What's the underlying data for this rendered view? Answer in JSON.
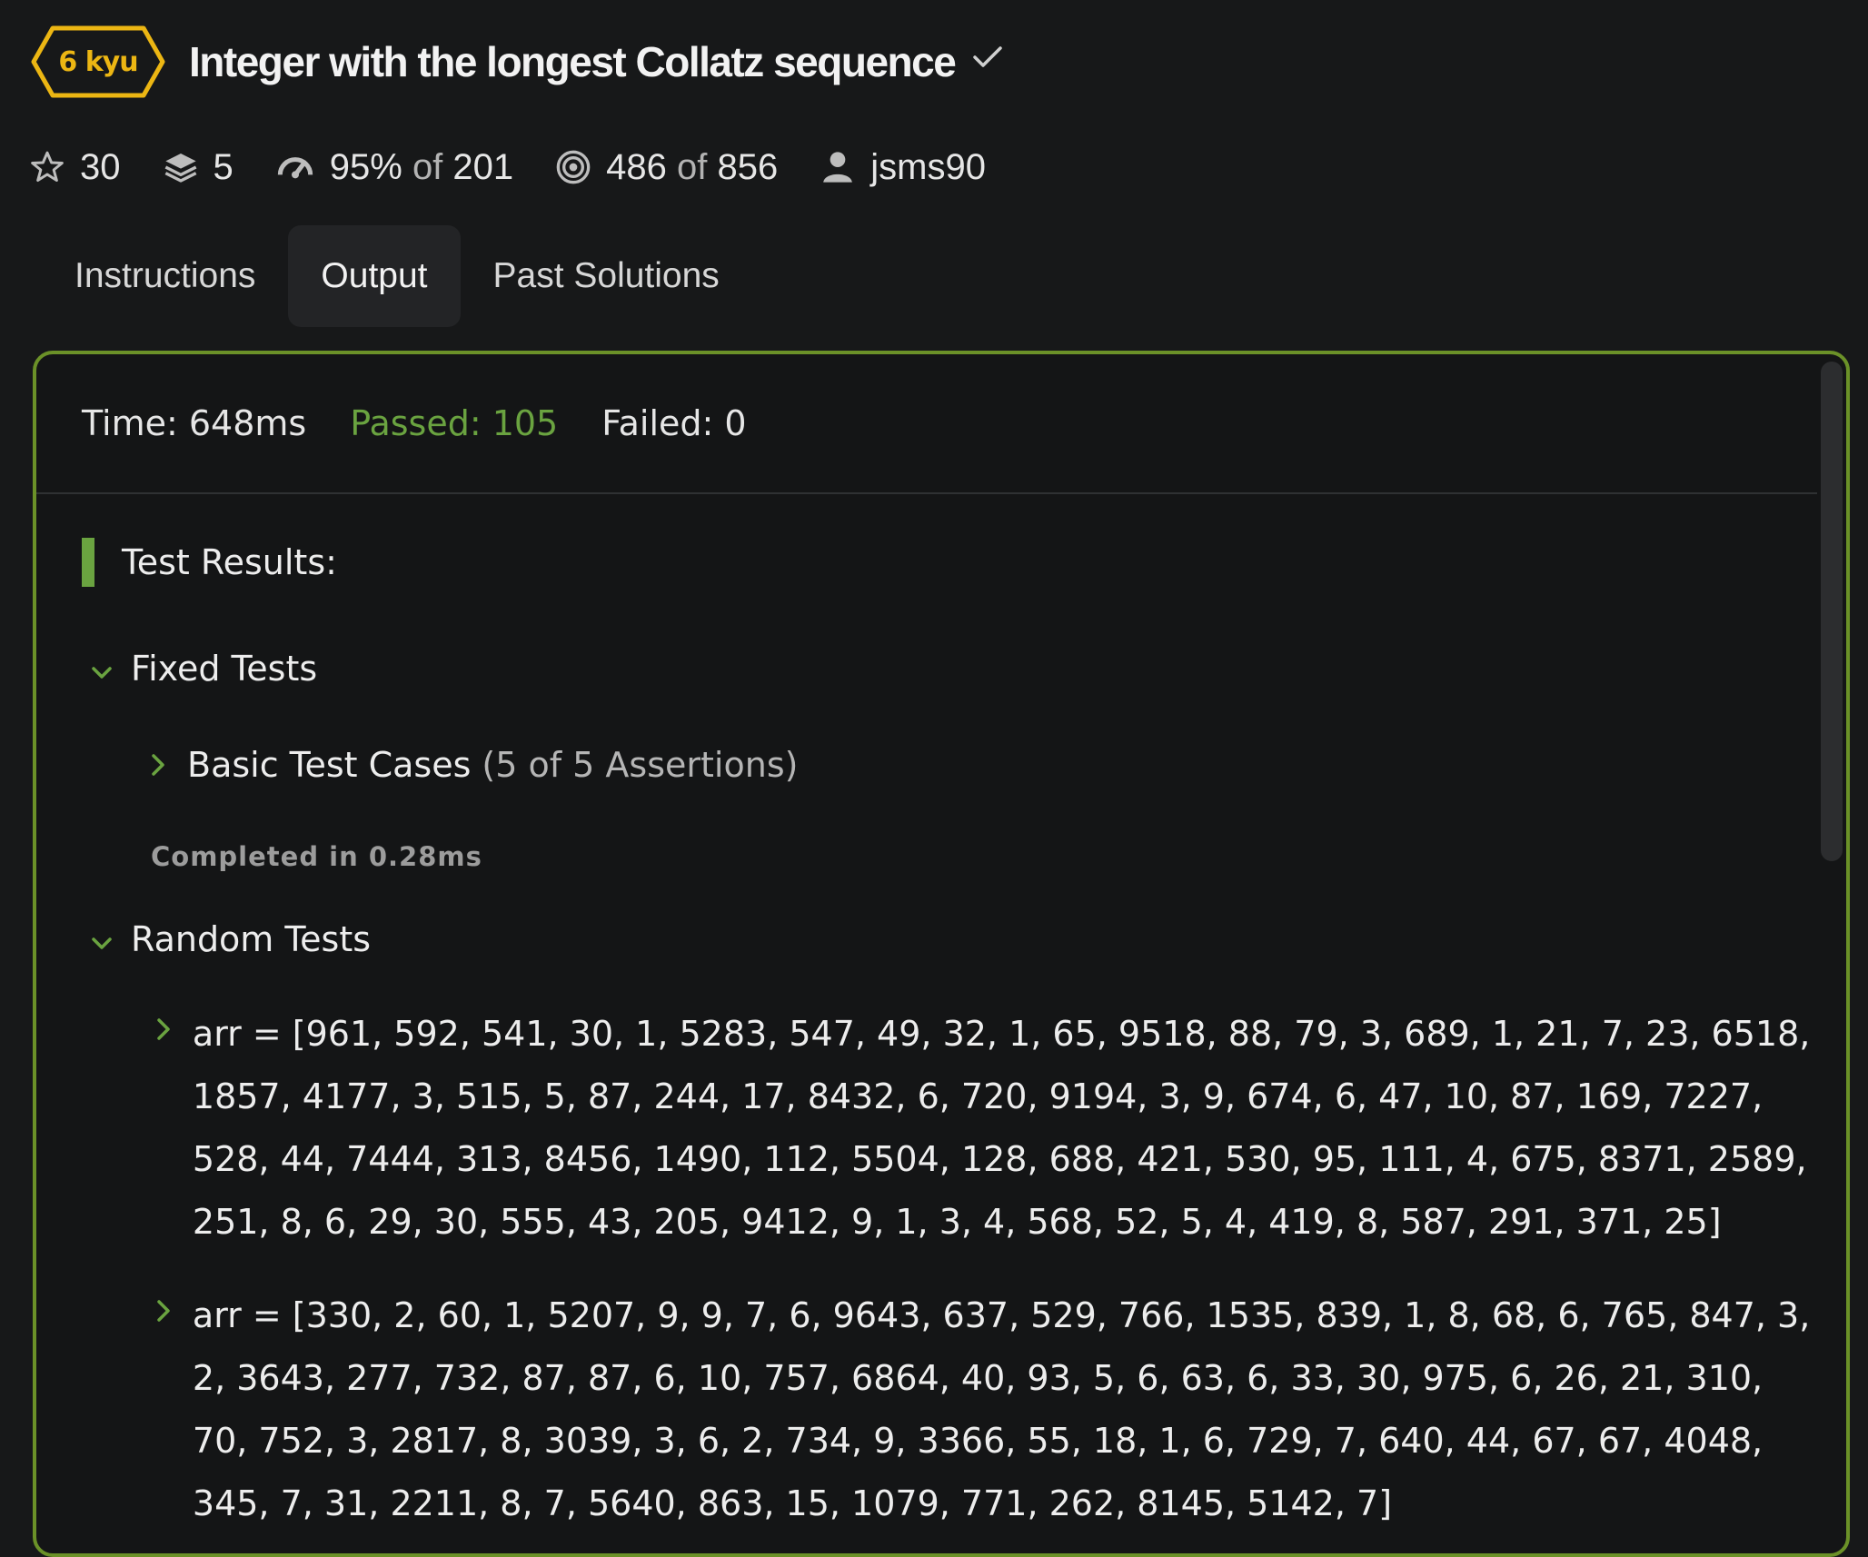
{
  "kata": {
    "rank": "6 kyu",
    "title": "Integer with the longest Collatz sequence",
    "colors": {
      "rank": "#ecb613",
      "accent": "#6aa340",
      "border": "#6b9128"
    }
  },
  "stats": {
    "stars": "30",
    "collections": "5",
    "satisfaction_value": "95%",
    "satisfaction_of": "of",
    "satisfaction_votes": "201",
    "completed_value": "486",
    "completed_of": "of",
    "completed_total": "856",
    "author": "jsms90"
  },
  "tabs": [
    {
      "label": "Instructions",
      "active": false
    },
    {
      "label": "Output",
      "active": true
    },
    {
      "label": "Past Solutions",
      "active": false
    }
  ],
  "summary": {
    "time": "Time: 648ms",
    "passed": "Passed: 105",
    "failed": "Failed: 0"
  },
  "results": {
    "title": "Test Results:",
    "fixed_tests": {
      "label": "Fixed Tests",
      "basic": {
        "label": "Basic Test Cases",
        "assertions": "(5 of 5 Assertions)"
      },
      "completed": "Completed in 0.28ms"
    },
    "random_tests": {
      "label": "Random Tests",
      "cases": [
        "arr = [961, 592, 541, 30, 1, 5283, 547, 49, 32, 1, 65, 9518, 88, 79, 3, 689, 1, 21, 7, 23, 6518, 1857, 4177, 3, 515, 5, 87, 244, 17, 8432, 6, 720, 9194, 3, 9, 674, 6, 47, 10, 87, 169, 7227, 528, 44, 7444, 313, 8456, 1490, 112, 5504, 128, 688, 421, 530, 95, 111, 4, 675, 8371, 2589, 251, 8, 6, 29, 30, 555, 43, 205, 9412, 9, 1, 3, 4, 568, 52, 5, 4, 419, 8, 587, 291, 371, 25]",
        "arr = [330, 2, 60, 1, 5207, 9, 9, 7, 6, 9643, 637, 529, 766, 1535, 839, 1, 8, 68, 6, 765, 847, 3, 2, 3643, 277, 732, 87, 87, 6, 10, 757, 6864, 40, 93, 5, 6, 63, 6, 33, 30, 975, 6, 26, 21, 310, 70, 752, 3, 2817, 8, 3039, 3, 6, 2, 734, 9, 3366, 55, 18, 1, 6, 729, 7, 640, 44, 67, 67, 4048, 345, 7, 31, 2211, 8, 7, 5640, 863, 15, 1079, 771, 262, 8145, 5142, 7]"
      ]
    }
  }
}
